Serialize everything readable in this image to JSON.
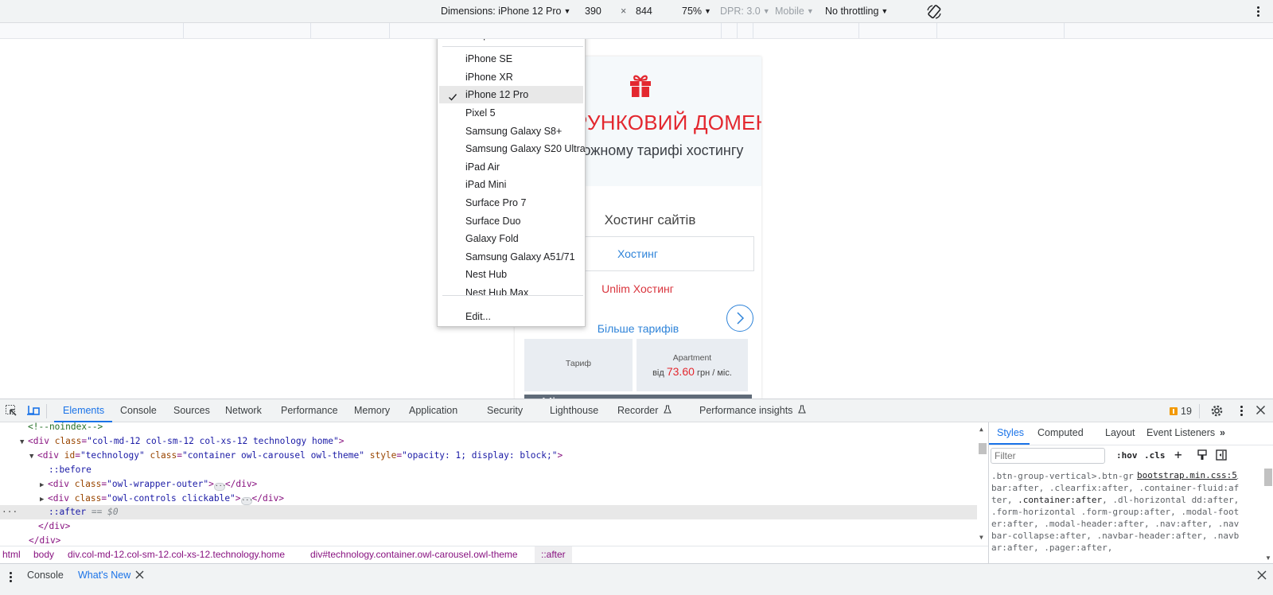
{
  "device_toolbar": {
    "dimensions_label": "Dimensions: iPhone 12 Pro",
    "width": "390",
    "times": "×",
    "height": "844",
    "zoom": "75%",
    "dpr": "DPR: 3.0",
    "device_type": "Mobile",
    "throttling": "No throttling",
    "rotate_icon": "rotate-icon",
    "more_icon": "more-vert-icon"
  },
  "device_menu": {
    "items": [
      {
        "label": "Responsive",
        "selected": false
      },
      {
        "label": "iPhone SE",
        "selected": false
      },
      {
        "label": "iPhone XR",
        "selected": false
      },
      {
        "label": "iPhone 12 Pro",
        "selected": true
      },
      {
        "label": "Pixel 5",
        "selected": false
      },
      {
        "label": "Samsung Galaxy S8+",
        "selected": false
      },
      {
        "label": "Samsung Galaxy S20 Ultra",
        "selected": false
      },
      {
        "label": "iPad Air",
        "selected": false
      },
      {
        "label": "iPad Mini",
        "selected": false
      },
      {
        "label": "Surface Pro 7",
        "selected": false
      },
      {
        "label": "Surface Duo",
        "selected": false
      },
      {
        "label": "Galaxy Fold",
        "selected": false
      },
      {
        "label": "Samsung Galaxy A51/71",
        "selected": false
      },
      {
        "label": "Nest Hub",
        "selected": false
      },
      {
        "label": "Nest Hub Max",
        "selected": false
      },
      {
        "label": "Edit...",
        "selected": false
      }
    ]
  },
  "page": {
    "promo_title": "ПОДАРУНКОВИЙ ДОМЕН",
    "promo_subtitle": "при кожному тарифі хостингу",
    "hosting_heading": "Хостинг сайтів",
    "tab_hosting": "Хостинг",
    "tab_unlim": "Unlim Хостинг",
    "more_tariffs": "Більше тарифів",
    "tariff_label": "Тариф",
    "plan_name": "Apartment",
    "price_prefix": "від",
    "price": "73.60",
    "price_suffix": "грн / міс.",
    "place_bar": "Місце на",
    "accent_red": "#e3282f",
    "accent_blue": "#2f84d9"
  },
  "devtools": {
    "tabs": [
      "Elements",
      "Console",
      "Sources",
      "Network",
      "Performance",
      "Memory",
      "Application",
      "Security",
      "Lighthouse",
      "Recorder",
      "Performance insights"
    ],
    "active_tab": "Elements",
    "issues_count": "19",
    "dom_lines": {
      "l0": "<!--noindex-->",
      "l1_tag_open": "<div",
      "l1_attr": "class",
      "l1_val": "\"col-md-12 col-sm-12 col-xs-12 technology home\"",
      "l2_attr1": "id",
      "l2_val1": "\"technology\"",
      "l2_attr2": "class",
      "l2_val2": "\"container owl-carousel owl-theme\"",
      "l2_attr3": "style",
      "l2_val3": "\"opacity: 1; display: block;\"",
      "l3": "::before",
      "l4_val": "\"owl-wrapper-outer\"",
      "l5_val": "\"owl-controls clickable\"",
      "l6": "::after",
      "l6_eq": "== $0",
      "close_div": "</div>"
    },
    "breadcrumb": [
      "html",
      "body",
      "div.col-md-12.col-sm-12.col-xs-12.technology.home",
      "div#technology.container.owl-carousel.owl-theme",
      "::after"
    ],
    "styles": {
      "tabs": [
        "Styles",
        "Computed",
        "Layout",
        "Event Listeners"
      ],
      "active_tab": "Styles",
      "filter_placeholder": "Filter",
      "hov": ":hov",
      "cls": ".cls",
      "rule_source": "bootstrap.min.css:5",
      "rule_part1": ".btn-group-vertical>.btn-group:after, .btn-toolbar:after, .clearfix:after, .container-fluid:after, ",
      "rule_highlight": ".container:after",
      "rule_part2": ", .dl-horizontal dd:after, .form-horizontal .form-group:after, .modal-footer:after, .modal-header:after, .nav:after, .navbar-collapse:after, .navbar-header:after, .navbar:after, .pager:after,"
    },
    "drawer": {
      "tabs": [
        "Console",
        "What's New"
      ],
      "active_tab": "What's New"
    }
  }
}
